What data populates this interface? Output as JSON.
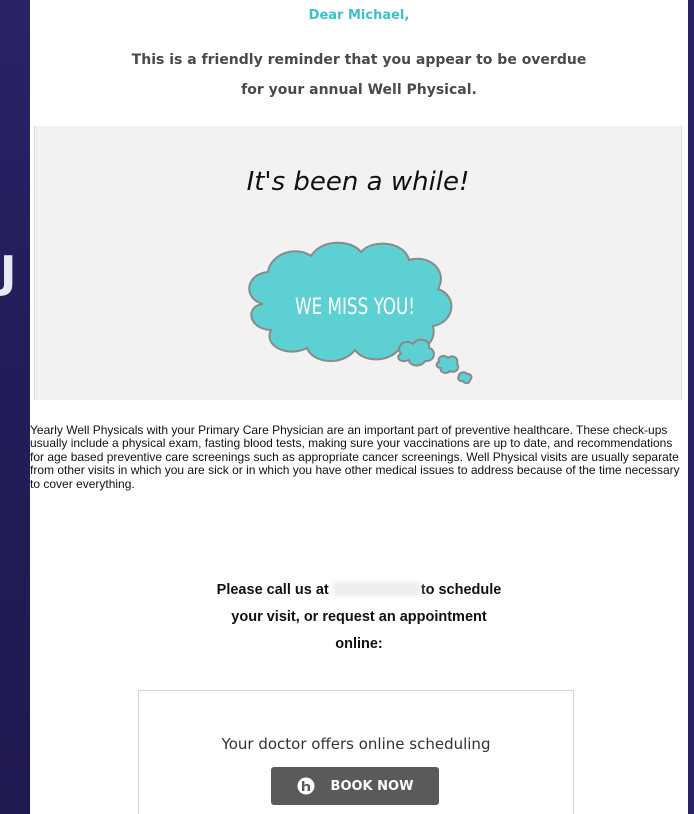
{
  "email": {
    "greeting": "Dear Michael,",
    "reminder_line1": "This is a friendly reminder that you appear to be overdue",
    "reminder_line2": "for your annual Well Physical."
  },
  "hero": {
    "title": "It's been a while!",
    "cloud_text": "WE MISS YOU!"
  },
  "body": {
    "paragraph": "Yearly Well Physicals with your Primary Care Physician are an important part of preventive healthcare. These check-ups usually include a physical exam, fasting blood tests, making sure your vaccinations are up to date, and recommendations for age based preventive care screenings such as appropriate cancer screenings. Well Physical visits are usually separate from other visits in which you are sick or in which you have other medical issues to address because of the time necessary to cover everything."
  },
  "cta": {
    "prefix": "Please call us at",
    "suffix": "to schedule",
    "line2": "your visit, or request an appointment",
    "line3": "online:"
  },
  "scheduling": {
    "text": "Your doctor offers online scheduling",
    "button_label": "BOOK NOW"
  },
  "colors": {
    "accent": "#3cc1c8",
    "cloud_fill": "#5dd0d4",
    "button_bg": "#5a5a5a",
    "background": "#2b2466"
  },
  "icons": {
    "book_logo": "booking-logo-icon"
  }
}
